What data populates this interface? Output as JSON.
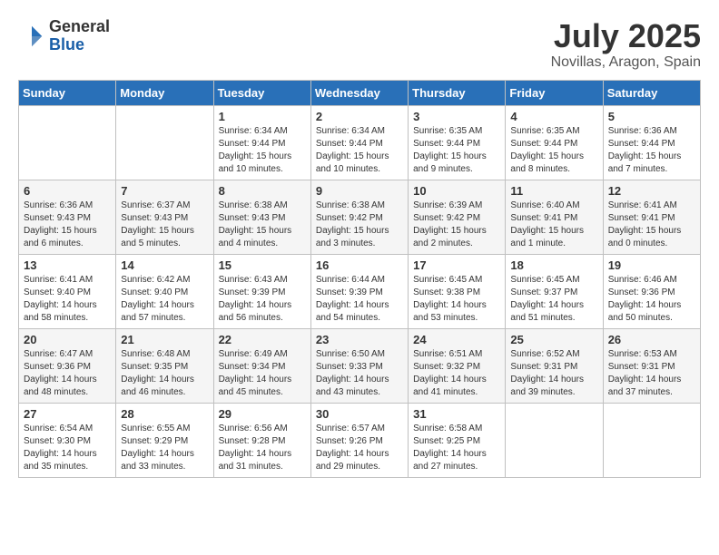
{
  "header": {
    "logo_general": "General",
    "logo_blue": "Blue",
    "month_title": "July 2025",
    "location": "Novillas, Aragon, Spain"
  },
  "weekdays": [
    "Sunday",
    "Monday",
    "Tuesday",
    "Wednesday",
    "Thursday",
    "Friday",
    "Saturday"
  ],
  "weeks": [
    [
      {
        "day": "",
        "info": ""
      },
      {
        "day": "",
        "info": ""
      },
      {
        "day": "1",
        "info": "Sunrise: 6:34 AM\nSunset: 9:44 PM\nDaylight: 15 hours\nand 10 minutes."
      },
      {
        "day": "2",
        "info": "Sunrise: 6:34 AM\nSunset: 9:44 PM\nDaylight: 15 hours\nand 10 minutes."
      },
      {
        "day": "3",
        "info": "Sunrise: 6:35 AM\nSunset: 9:44 PM\nDaylight: 15 hours\nand 9 minutes."
      },
      {
        "day": "4",
        "info": "Sunrise: 6:35 AM\nSunset: 9:44 PM\nDaylight: 15 hours\nand 8 minutes."
      },
      {
        "day": "5",
        "info": "Sunrise: 6:36 AM\nSunset: 9:44 PM\nDaylight: 15 hours\nand 7 minutes."
      }
    ],
    [
      {
        "day": "6",
        "info": "Sunrise: 6:36 AM\nSunset: 9:43 PM\nDaylight: 15 hours\nand 6 minutes."
      },
      {
        "day": "7",
        "info": "Sunrise: 6:37 AM\nSunset: 9:43 PM\nDaylight: 15 hours\nand 5 minutes."
      },
      {
        "day": "8",
        "info": "Sunrise: 6:38 AM\nSunset: 9:43 PM\nDaylight: 15 hours\nand 4 minutes."
      },
      {
        "day": "9",
        "info": "Sunrise: 6:38 AM\nSunset: 9:42 PM\nDaylight: 15 hours\nand 3 minutes."
      },
      {
        "day": "10",
        "info": "Sunrise: 6:39 AM\nSunset: 9:42 PM\nDaylight: 15 hours\nand 2 minutes."
      },
      {
        "day": "11",
        "info": "Sunrise: 6:40 AM\nSunset: 9:41 PM\nDaylight: 15 hours\nand 1 minute."
      },
      {
        "day": "12",
        "info": "Sunrise: 6:41 AM\nSunset: 9:41 PM\nDaylight: 15 hours\nand 0 minutes."
      }
    ],
    [
      {
        "day": "13",
        "info": "Sunrise: 6:41 AM\nSunset: 9:40 PM\nDaylight: 14 hours\nand 58 minutes."
      },
      {
        "day": "14",
        "info": "Sunrise: 6:42 AM\nSunset: 9:40 PM\nDaylight: 14 hours\nand 57 minutes."
      },
      {
        "day": "15",
        "info": "Sunrise: 6:43 AM\nSunset: 9:39 PM\nDaylight: 14 hours\nand 56 minutes."
      },
      {
        "day": "16",
        "info": "Sunrise: 6:44 AM\nSunset: 9:39 PM\nDaylight: 14 hours\nand 54 minutes."
      },
      {
        "day": "17",
        "info": "Sunrise: 6:45 AM\nSunset: 9:38 PM\nDaylight: 14 hours\nand 53 minutes."
      },
      {
        "day": "18",
        "info": "Sunrise: 6:45 AM\nSunset: 9:37 PM\nDaylight: 14 hours\nand 51 minutes."
      },
      {
        "day": "19",
        "info": "Sunrise: 6:46 AM\nSunset: 9:36 PM\nDaylight: 14 hours\nand 50 minutes."
      }
    ],
    [
      {
        "day": "20",
        "info": "Sunrise: 6:47 AM\nSunset: 9:36 PM\nDaylight: 14 hours\nand 48 minutes."
      },
      {
        "day": "21",
        "info": "Sunrise: 6:48 AM\nSunset: 9:35 PM\nDaylight: 14 hours\nand 46 minutes."
      },
      {
        "day": "22",
        "info": "Sunrise: 6:49 AM\nSunset: 9:34 PM\nDaylight: 14 hours\nand 45 minutes."
      },
      {
        "day": "23",
        "info": "Sunrise: 6:50 AM\nSunset: 9:33 PM\nDaylight: 14 hours\nand 43 minutes."
      },
      {
        "day": "24",
        "info": "Sunrise: 6:51 AM\nSunset: 9:32 PM\nDaylight: 14 hours\nand 41 minutes."
      },
      {
        "day": "25",
        "info": "Sunrise: 6:52 AM\nSunset: 9:31 PM\nDaylight: 14 hours\nand 39 minutes."
      },
      {
        "day": "26",
        "info": "Sunrise: 6:53 AM\nSunset: 9:31 PM\nDaylight: 14 hours\nand 37 minutes."
      }
    ],
    [
      {
        "day": "27",
        "info": "Sunrise: 6:54 AM\nSunset: 9:30 PM\nDaylight: 14 hours\nand 35 minutes."
      },
      {
        "day": "28",
        "info": "Sunrise: 6:55 AM\nSunset: 9:29 PM\nDaylight: 14 hours\nand 33 minutes."
      },
      {
        "day": "29",
        "info": "Sunrise: 6:56 AM\nSunset: 9:28 PM\nDaylight: 14 hours\nand 31 minutes."
      },
      {
        "day": "30",
        "info": "Sunrise: 6:57 AM\nSunset: 9:26 PM\nDaylight: 14 hours\nand 29 minutes."
      },
      {
        "day": "31",
        "info": "Sunrise: 6:58 AM\nSunset: 9:25 PM\nDaylight: 14 hours\nand 27 minutes."
      },
      {
        "day": "",
        "info": ""
      },
      {
        "day": "",
        "info": ""
      }
    ]
  ]
}
